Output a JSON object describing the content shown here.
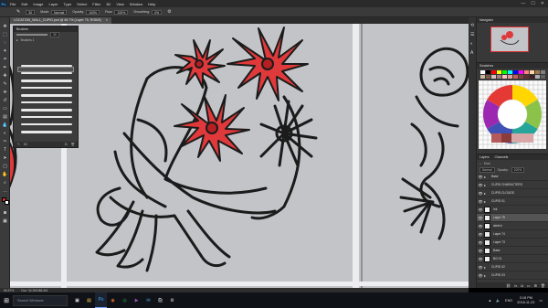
{
  "app": {
    "logo": "Ps",
    "menus": [
      "File",
      "Edit",
      "Image",
      "Layer",
      "Type",
      "Select",
      "Filter",
      "3D",
      "View",
      "Window",
      "Help"
    ],
    "window_controls": [
      "—",
      "☐",
      "✕"
    ]
  },
  "options_bar": {
    "mode_label": "Mode:",
    "mode_value": "Normal",
    "opacity_label": "Opacity:",
    "opacity_value": "100%",
    "flow_label": "Flow:",
    "flow_value": "100%",
    "smoothing_label": "Smoothing:",
    "smoothing_value": "0%"
  },
  "document_tab": {
    "title": "LOCATION_WALL_CUPID.psd @ 66.7% (Layer 75, RGB/8)",
    "close": "×"
  },
  "brush_panel": {
    "title": "Brushes",
    "size_value": "30",
    "preset_label": "Brushes 1",
    "footer_value": "80"
  },
  "navigator": {
    "title": "Navigator"
  },
  "swatches": {
    "tabs": [
      "Swatches"
    ],
    "row1": [
      "#ffffff",
      "#000000",
      "#ff0000",
      "#ffff00",
      "#00ff00",
      "#00ffff",
      "#0000ff",
      "#ff00ff",
      "#ff8080",
      "#ffd7a0",
      "#a07850",
      "#808080"
    ],
    "row2": [
      "#c8b4a0",
      "#7a5a40",
      "#d0c0c0",
      "#a08080",
      "#ffc0c0",
      "#e0a0a0",
      "#c06060",
      "#804040",
      "#603030",
      "#402020",
      "#b0b0b0",
      "#606060"
    ]
  },
  "layers": {
    "tabs": [
      "Layers",
      "Channels"
    ],
    "kind_label": "Kind",
    "mode_value": "Normal",
    "opacity_label": "Opacity:",
    "opacity_value": "100%",
    "items": [
      {
        "name": "Base",
        "type": "folder"
      },
      {
        "name": "CUPID CHARACTERS",
        "type": "folder"
      },
      {
        "name": "CUPID CLOUDS",
        "type": "folder"
      },
      {
        "name": "CUPID 01",
        "type": "folder"
      },
      {
        "name": "Ink",
        "type": "layer"
      },
      {
        "name": "Layer 75",
        "type": "layer",
        "selected": true
      },
      {
        "name": "sketch",
        "type": "layer"
      },
      {
        "name": "Layer 74",
        "type": "layer"
      },
      {
        "name": "Layer 73",
        "type": "layer"
      },
      {
        "name": "Base",
        "type": "layer"
      },
      {
        "name": "BG 01",
        "type": "layer"
      },
      {
        "name": "CUPID 02",
        "type": "folder"
      },
      {
        "name": "CUPID 03",
        "type": "folder"
      }
    ]
  },
  "status_bar": {
    "zoom": "66.67%",
    "doc_info": "Doc: 34.2M/486.4M"
  },
  "taskbar": {
    "search_placeholder": "Search Windows",
    "language": "ENG",
    "time": "3:18 PM",
    "date": "2018-11-23"
  }
}
